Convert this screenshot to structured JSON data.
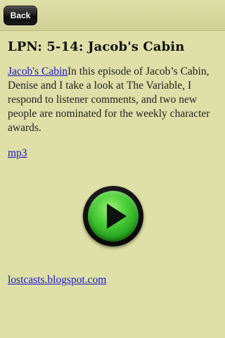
{
  "nav": {
    "back_label": "Back"
  },
  "episode": {
    "title": "LPN: 5-14: Jacob's Cabin",
    "inline_link": "Jacob's Cabin",
    "description": "In this episode of Jacob’s Cabin, Denise and I take a look at The Variable, I respond to listener comments, and two new people are nominated for the weekly character awards.",
    "mp3_link": "mp3"
  },
  "player": {
    "icon": "play-icon"
  },
  "footer": {
    "site_link": "lostcasts.blogspot.com"
  },
  "colors": {
    "background": "#dfe0a8",
    "link": "#1a16c8",
    "play_button_green": "#4ed13a"
  }
}
